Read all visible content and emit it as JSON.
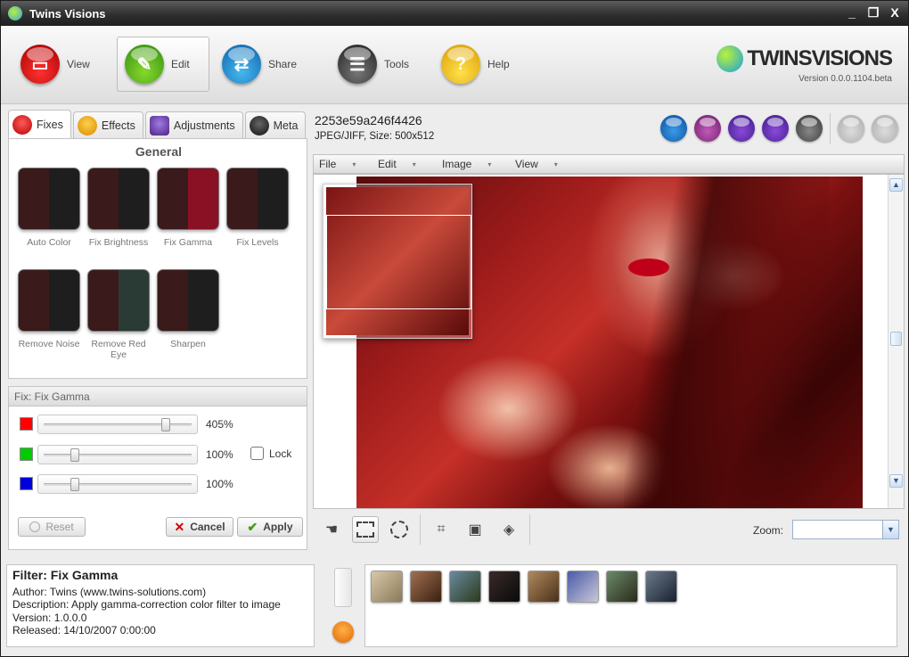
{
  "window": {
    "title": "Twins Visions",
    "controls": [
      "_",
      "❐",
      "X"
    ]
  },
  "ribbon": {
    "buttons": [
      {
        "label": "View",
        "icon": "film-strip-icon",
        "color": "#d40000"
      },
      {
        "label": "Edit",
        "icon": "brush-icon",
        "color": "#4aa818"
      },
      {
        "label": "Share",
        "icon": "share-arrows-icon",
        "color": "#1a7ccc"
      },
      {
        "label": "Tools",
        "icon": "tools-list-icon",
        "color": "#3a3a3a"
      },
      {
        "label": "Help",
        "icon": "help-question-icon",
        "color": "#f0b800"
      }
    ],
    "active": "Edit",
    "logo": {
      "text": "TWINSVISIONS",
      "version": "Version 0.0.0.1104.beta"
    }
  },
  "left_tabs": [
    {
      "label": "Fixes",
      "active": true,
      "color": "#d42828"
    },
    {
      "label": "Effects",
      "active": false,
      "color": "#e8a000"
    },
    {
      "label": "Adjustments",
      "active": false,
      "color": "#6a3aa8"
    },
    {
      "label": "Meta",
      "active": false,
      "color": "#222222"
    }
  ],
  "gallery": {
    "section": "General",
    "items": [
      "Auto Color",
      "Fix Brightness",
      "Fix Gamma",
      "Fix Levels",
      "Remove Noise",
      "Remove Red Eye",
      "Sharpen"
    ]
  },
  "fix_panel": {
    "title": "Fix: Fix Gamma",
    "sliders": [
      {
        "channel": "red",
        "color": "#ff0000",
        "value": "405%",
        "level": 0.84
      },
      {
        "channel": "green",
        "color": "#00cc00",
        "value": "100%",
        "level": 0.2
      },
      {
        "channel": "blue",
        "color": "#0000dd",
        "value": "100%",
        "level": 0.2
      }
    ],
    "lock_label": "Lock",
    "lock_checked": false,
    "buttons": {
      "reset": "Reset",
      "cancel": "Cancel",
      "apply": "Apply"
    }
  },
  "info": {
    "title": "Filter: Fix Gamma",
    "author": "Author: Twins (www.twins-solutions.com)",
    "description": "Description: Apply gamma-correction color filter to image",
    "version": "Version: 1.0.0.0",
    "released": "Released: 14/10/2007 0:00:00"
  },
  "image": {
    "name": "2253e59a246f4426",
    "details": "JPEG/JIFF, Size: 500x512"
  },
  "toolbar_icons": [
    "upload-icon",
    "print-preview-icon",
    "save-icon",
    "save-as-icon",
    "print-icon",
    "undo-icon",
    "redo-icon"
  ],
  "menu": [
    "File",
    "Edit",
    "Image",
    "View"
  ],
  "bottom_tools": [
    "hand-icon",
    "rect-select-icon",
    "ellipse-select-icon",
    "crop-icon",
    "resize-icon",
    "rotate-icon"
  ],
  "zoom": {
    "label": "Zoom:",
    "value": ""
  },
  "filmstrip": {
    "count": 8
  }
}
